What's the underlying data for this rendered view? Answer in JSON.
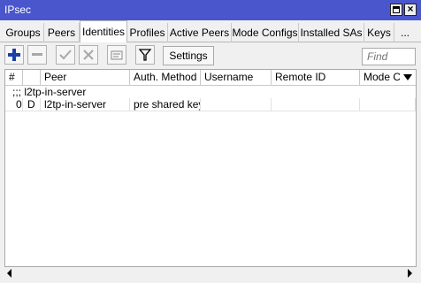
{
  "window": {
    "title": "IPsec"
  },
  "tabs": [
    {
      "label": "Groups"
    },
    {
      "label": "Peers"
    },
    {
      "label": "Identities",
      "active": true
    },
    {
      "label": "Profiles"
    },
    {
      "label": "Active Peers"
    },
    {
      "label": "Mode Configs"
    },
    {
      "label": "Installed SAs"
    },
    {
      "label": "Keys"
    },
    {
      "label": "..."
    }
  ],
  "toolbar": {
    "icons": [
      "plus-icon",
      "minus-icon",
      "check-icon",
      "cross-icon",
      "comment-icon",
      "filter-icon"
    ],
    "settings_label": "Settings",
    "find_placeholder": "Find"
  },
  "table": {
    "columns": [
      "#",
      "",
      "Peer",
      "Auth. Method",
      "Username",
      "Remote ID",
      "Mode Cor"
    ],
    "comment_row": ";;; l2tp-in-server",
    "rows": [
      {
        "num": "0",
        "flag": "D",
        "peer": "l2tp-in-server",
        "auth_method": "pre shared key",
        "username": "",
        "remote_id": "",
        "mode_config": ""
      }
    ]
  },
  "colors": {
    "titlebar": "#4a56cc",
    "add_icon": "#1b3fa8"
  }
}
